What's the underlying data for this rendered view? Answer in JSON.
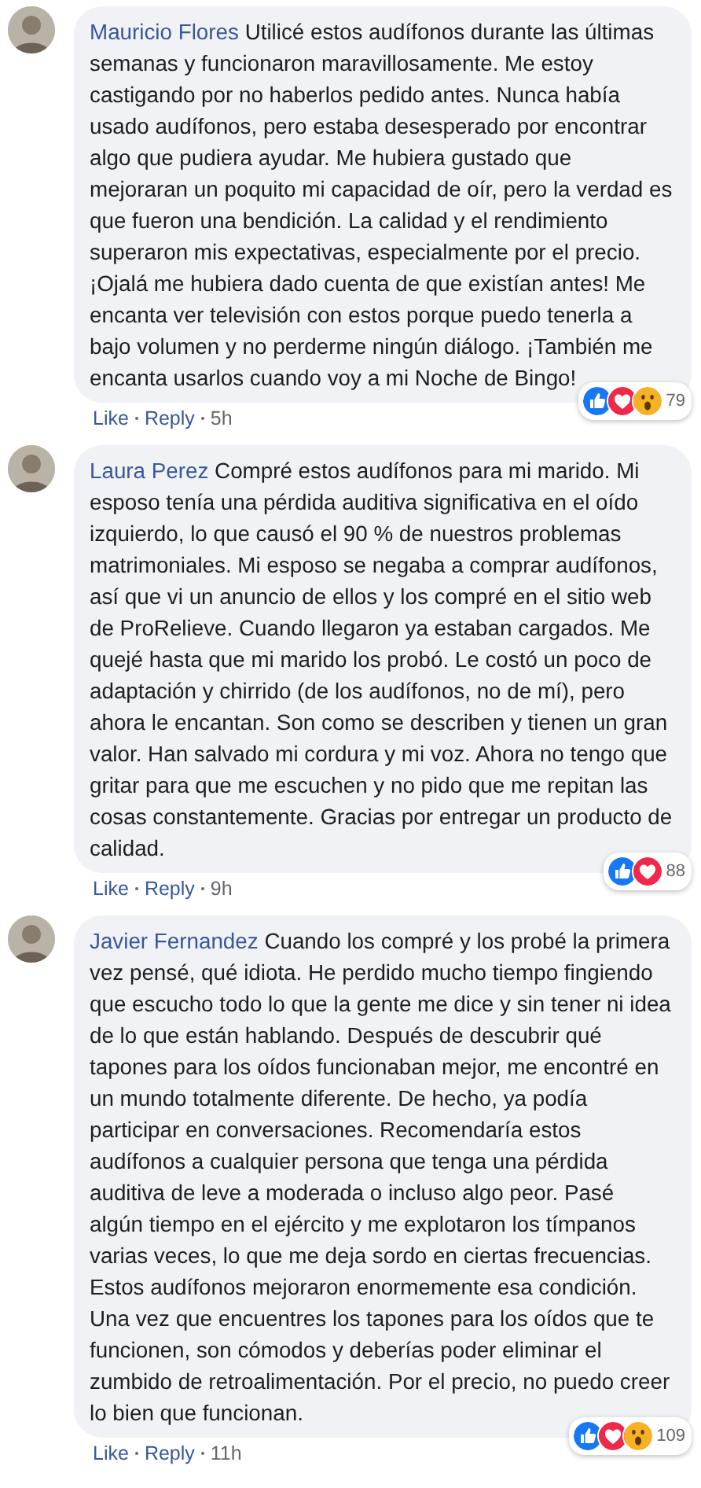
{
  "comments": [
    {
      "author": "Mauricio Flores",
      "text": "Utilicé estos audífonos durante las últimas semanas y funcionaron maravillosamente. Me estoy castigando por no haberlos pedido antes. Nunca había usado audífonos, pero estaba desesperado por encontrar algo que pudiera ayudar. Me hubiera gustado que mejoraran un poquito mi capacidad de oír, pero la verdad es que fueron una bendición. La calidad y el rendimiento superaron mis expectativas, especialmente por el precio. ¡Ojalá me hubiera dado cuenta de que existían antes! Me encanta ver televisión con estos porque puedo tenerla a bajo volumen y no perderme ningún diálogo. ¡También me encanta usarlos cuando voy a mi Noche de Bingo!",
      "reactions": [
        {
          "kind": "like"
        },
        {
          "kind": "love"
        },
        {
          "kind": "wow"
        }
      ],
      "reaction_count": "79",
      "like": "Like",
      "reply": "Reply",
      "time": "5h"
    },
    {
      "author": "Laura Perez",
      "text": "Compré estos audífonos para mi marido. Mi esposo tenía una pérdida auditiva significativa en el oído izquierdo, lo que causó el 90 % de nuestros problemas matrimoniales. Mi esposo se negaba a comprar audífonos, así que vi un anuncio de ellos y los compré en el sitio web de ProRelieve. Cuando llegaron ya estaban cargados. Me quejé hasta que mi marido los probó. Le costó un poco de adaptación y chirrido (de los audífonos, no de mí), pero ahora le encantan. Son como se describen y tienen un gran valor. Han salvado mi cordura y mi voz. Ahora no tengo que gritar para que me escuchen y no pido que me repitan las cosas constantemente. Gracias por entregar un producto de calidad.",
      "reactions": [
        {
          "kind": "like"
        },
        {
          "kind": "love"
        }
      ],
      "reaction_count": "88",
      "like": "Like",
      "reply": "Reply",
      "time": "9h"
    },
    {
      "author": "Javier Fernandez",
      "text": "Cuando los compré y los probé la primera vez pensé, qué idiota. He perdido mucho tiempo fingiendo que escucho todo lo que la gente me dice y sin tener ni idea de lo que están hablando. Después de descubrir qué tapones para los oídos funcionaban mejor, me encontré en un mundo totalmente diferente. De hecho, ya podía participar en conversaciones. Recomendaría estos audífonos a cualquier persona que tenga una pérdida auditiva de leve a moderada o incluso algo peor. Pasé algún tiempo en el ejército y me explotaron los tímpanos varias veces, lo que me deja sordo en ciertas frecuencias. Estos audífonos mejoraron enormemente esa condición. Una vez que encuentres los tapones para los oídos que te funcionen, son cómodos y deberías poder eliminar el zumbido de retroalimentación. Por el precio, no puedo creer lo bien que funcionan.",
      "reactions": [
        {
          "kind": "like"
        },
        {
          "kind": "love"
        },
        {
          "kind": "wow"
        }
      ],
      "reaction_count": "109",
      "like": "Like",
      "reply": "Reply",
      "time": "11h"
    }
  ]
}
